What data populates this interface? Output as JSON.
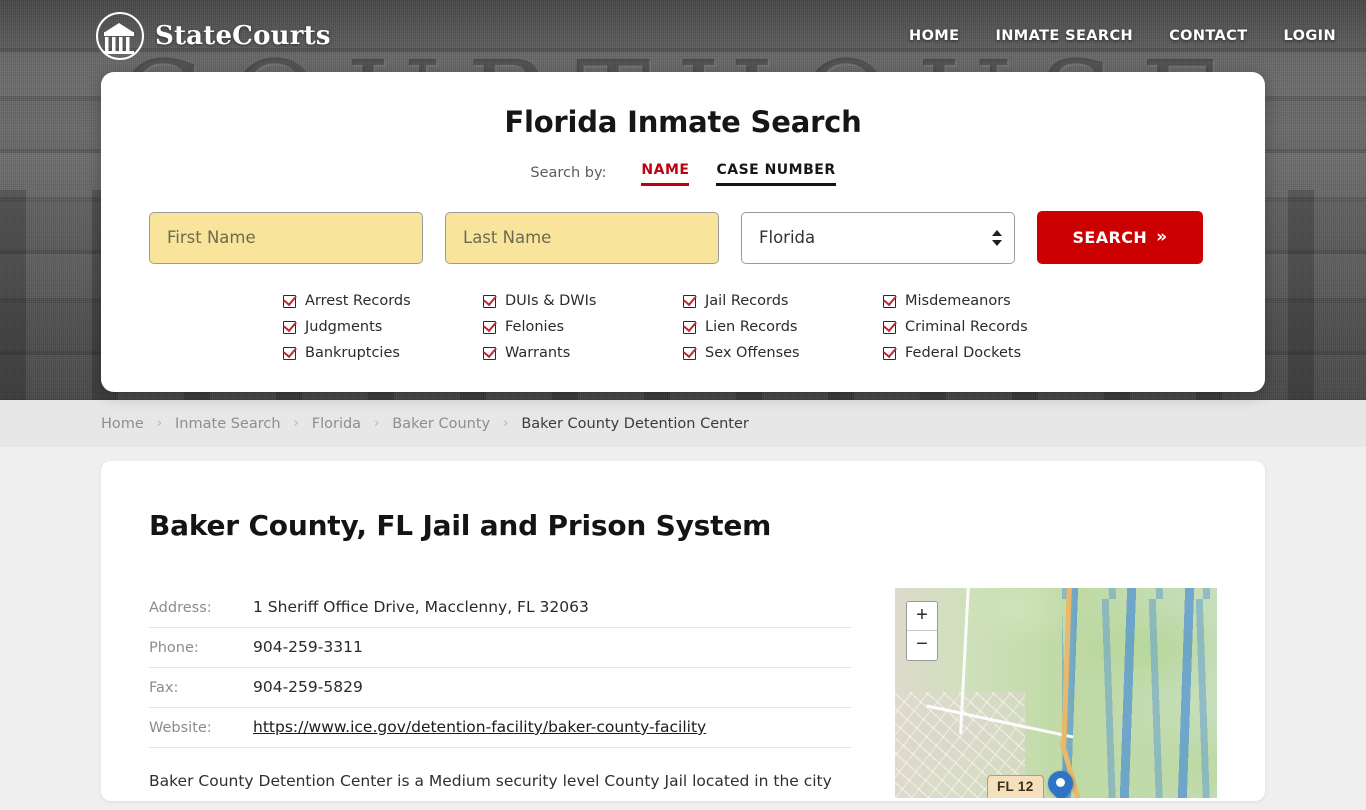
{
  "header": {
    "brand_name": "StateCourts",
    "logo_icon": "courthouse-circle-icon",
    "background_word": "COURTHOUSE",
    "nav": [
      {
        "label": "HOME"
      },
      {
        "label": "INMATE SEARCH"
      },
      {
        "label": "CONTACT"
      },
      {
        "label": "LOGIN"
      }
    ]
  },
  "search_card": {
    "title": "Florida Inmate Search",
    "search_by_label": "Search by:",
    "tabs": [
      {
        "label": "NAME",
        "active": true
      },
      {
        "label": "CASE NUMBER",
        "active": false
      }
    ],
    "first_name_placeholder": "First Name",
    "last_name_placeholder": "Last Name",
    "state_value": "Florida",
    "state_options": [
      "Florida"
    ],
    "search_button": "SEARCH",
    "search_button_chevron": "»",
    "checkboxes": [
      "Arrest Records",
      "DUIs & DWIs",
      "Jail Records",
      "Misdemeanors",
      "Judgments",
      "Felonies",
      "Lien Records",
      "Criminal Records",
      "Bankruptcies",
      "Warrants",
      "Sex Offenses",
      "Federal Dockets"
    ],
    "accent_red": "#cc0000",
    "input_yellow": "#f9e49c"
  },
  "breadcrumb": {
    "separator": "›",
    "items": [
      {
        "label": "Home",
        "current": false
      },
      {
        "label": "Inmate Search",
        "current": false
      },
      {
        "label": "Florida",
        "current": false
      },
      {
        "label": "Baker County",
        "current": false
      },
      {
        "label": "Baker County Detention Center",
        "current": true
      }
    ]
  },
  "main": {
    "page_title": "Baker County, FL Jail and Prison System",
    "details": [
      {
        "key": "Address:",
        "value": "1 Sheriff Office Drive, Macclenny, FL 32063",
        "is_link": false
      },
      {
        "key": "Phone:",
        "value": "904-259-3311",
        "is_link": false
      },
      {
        "key": "Fax:",
        "value": "904-259-5829",
        "is_link": false
      },
      {
        "key": "Website:",
        "value": "https://www.ice.gov/detention-facility/baker-county-facility",
        "is_link": true
      }
    ],
    "description": "Baker County Detention Center is a Medium security level County Jail located in the city"
  },
  "map": {
    "zoom_in_label": "+",
    "zoom_out_label": "−",
    "road_label": "FL 12",
    "marker_icon": "location-pin-icon",
    "marker_color": "#2d74c8"
  }
}
